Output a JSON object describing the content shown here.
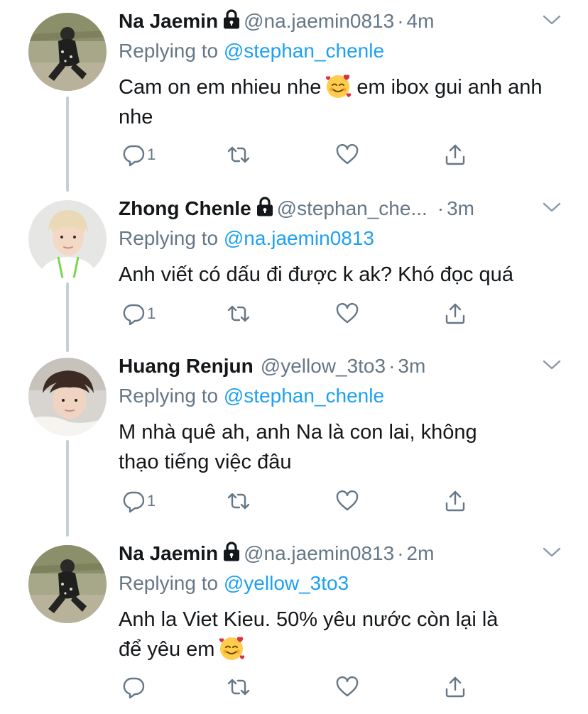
{
  "tweets": [
    {
      "name": "Na Jaemin",
      "protected": true,
      "handle": "@na.jaemin0813",
      "separator": "·",
      "time": "4m",
      "replying_prefix": "Replying to",
      "replying_to": "@stephan_chenle",
      "text_before_emoji": "Cam on em nhieu nhe",
      "emoji": "smiling-face-with-hearts",
      "text_after_emoji": "em ibox gui anh anh nhe",
      "reply_count": "1",
      "avatar": "jaemin-avatar"
    },
    {
      "name": "Zhong Chenle",
      "protected": true,
      "handle": "@stephan_che...",
      "separator": "·",
      "time": "3m",
      "replying_prefix": "Replying to",
      "replying_to": "@na.jaemin0813",
      "text": "Anh viết có dấu đi được k ak? Khó đọc quá",
      "reply_count": "1",
      "avatar": "chenle-avatar"
    },
    {
      "name": "Huang Renjun",
      "protected": false,
      "handle": "@yellow_3to3",
      "separator": "·",
      "time": "3m",
      "replying_prefix": "Replying to",
      "replying_to": "@stephan_chenle",
      "text_line1": "M nhà quê ah, anh Na là con lai, không",
      "text_line2": "thạo tiếng việc đâu",
      "reply_count": "1",
      "avatar": "renjun-avatar"
    },
    {
      "name": "Na Jaemin",
      "protected": true,
      "handle": "@na.jaemin0813",
      "separator": "·",
      "time": "2m",
      "replying_prefix": "Replying to",
      "replying_to": "@yellow_3to3",
      "text_line1": "Anh la Viet Kieu. 50% yêu nước còn lại là",
      "text_line2_before_emoji": "để yêu em",
      "emoji": "smiling-face-with-hearts",
      "reply_count": "",
      "avatar": "jaemin-avatar"
    }
  ],
  "colors": {
    "text": "#14171a",
    "secondary": "#657786",
    "link": "#1da1f2",
    "thread_line": "#c4cfd6"
  },
  "icons": {
    "reply": "reply-icon",
    "retweet": "retweet-icon",
    "like": "like-icon",
    "share": "share-icon",
    "more": "chevron-down-icon",
    "protected": "lock-icon"
  }
}
